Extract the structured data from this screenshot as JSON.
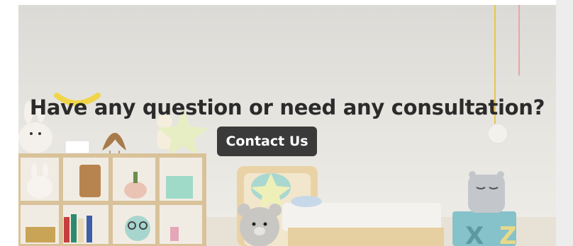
{
  "banner": {
    "headline": "Have any question or need any consultation?",
    "cta_label": "Contact Us"
  },
  "colors": {
    "headline": "#2b2b2b",
    "cta_background": "#3a3a3a",
    "cta_text": "#ffffff"
  },
  "icons": [
    "bunny-plush",
    "bird-figurines",
    "star-cushion",
    "teddy-bear",
    "toy-chest"
  ]
}
